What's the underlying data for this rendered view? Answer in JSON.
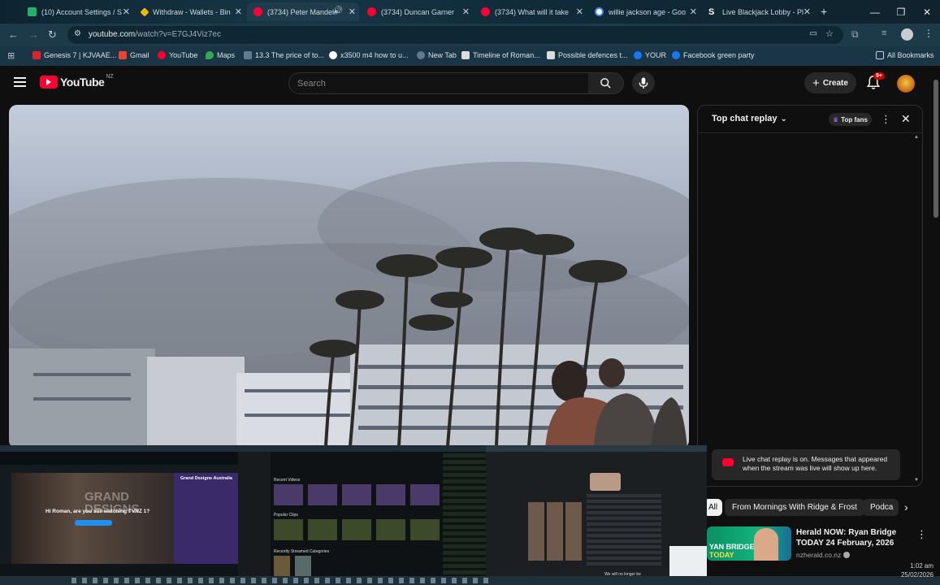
{
  "browser": {
    "tabs": [
      {
        "title": "(10) Account Settings / S",
        "color": "#1fb36e"
      },
      {
        "title": "Withdraw - Wallets - Bin",
        "color": "#f0b90b"
      },
      {
        "title": "(3734) Peter Mandel",
        "color": "#ff0033"
      },
      {
        "title": "(3734) Duncan Garner",
        "color": "#ff0033"
      },
      {
        "title": "(3734) What will it take",
        "color": "#ff0033"
      },
      {
        "title": "willie jackson age - Goo",
        "color": "#4285f4"
      },
      {
        "title": "Live Blackjack Lobby - Pl",
        "color": "#7a5cff"
      }
    ],
    "url_host": "youtube.com",
    "url_path": "/watch?v=E7GJ4Viz7ec",
    "bookmarks": [
      {
        "label": "Genesis 7 | KJVAAE...",
        "color": "#d23"
      },
      {
        "label": "Gmail",
        "color": "#ea4335"
      },
      {
        "label": "YouTube",
        "color": "#ff0033"
      },
      {
        "label": "Maps",
        "color": "#34a853"
      },
      {
        "label": "13.3 The price of to...",
        "color": "#5f7d8c"
      },
      {
        "label": "x3500 m4 how to u...",
        "color": "#4285f4"
      },
      {
        "label": "New Tab",
        "color": "#5f7d8c"
      },
      {
        "label": "Timeline of Roman...",
        "color": "#ddd"
      },
      {
        "label": "Possible defences t...",
        "color": "#ddd"
      },
      {
        "label": "YOUR",
        "color": "#1877f2"
      },
      {
        "label": "Facebook green party",
        "color": "#1877f2"
      }
    ],
    "all_bookmarks": "All Bookmarks"
  },
  "youtube": {
    "logo_text": "YouTube",
    "region": "NZ",
    "search_placeholder": "Search",
    "create_label": "Create",
    "notifications_badge": "9+"
  },
  "chat": {
    "title": "Top chat replay",
    "top_fans": "Top fans",
    "notice": "Live chat replay is on. Messages that appeared when the stream was live will show up here."
  },
  "chips": [
    "All",
    "From Mornings With Ridge & Frost",
    "Podca"
  ],
  "related": {
    "title_line1": "Herald NOW: Ryan Bridge",
    "title_line2": "TODAY 24 February, 2026",
    "channel": "nzherald.co.nz",
    "thumb_text": "YAN BRIDGE",
    "thumb_text2": "TODAY"
  },
  "thumbnails": {
    "t1_title": "Grand Designs Australia",
    "t1_overlay": "GRAND DESIGNS",
    "t1_question": "Hi Roman, are you still watching TVNZ 1?",
    "t2_sec1": "Recent Videos",
    "t2_sec2": "Popular Clips",
    "t2_sec3": "Recently Streamed Categories",
    "t3_footer": "We will no longer be"
  },
  "system": {
    "time": "1:02 am",
    "date": "25/02/2026"
  }
}
